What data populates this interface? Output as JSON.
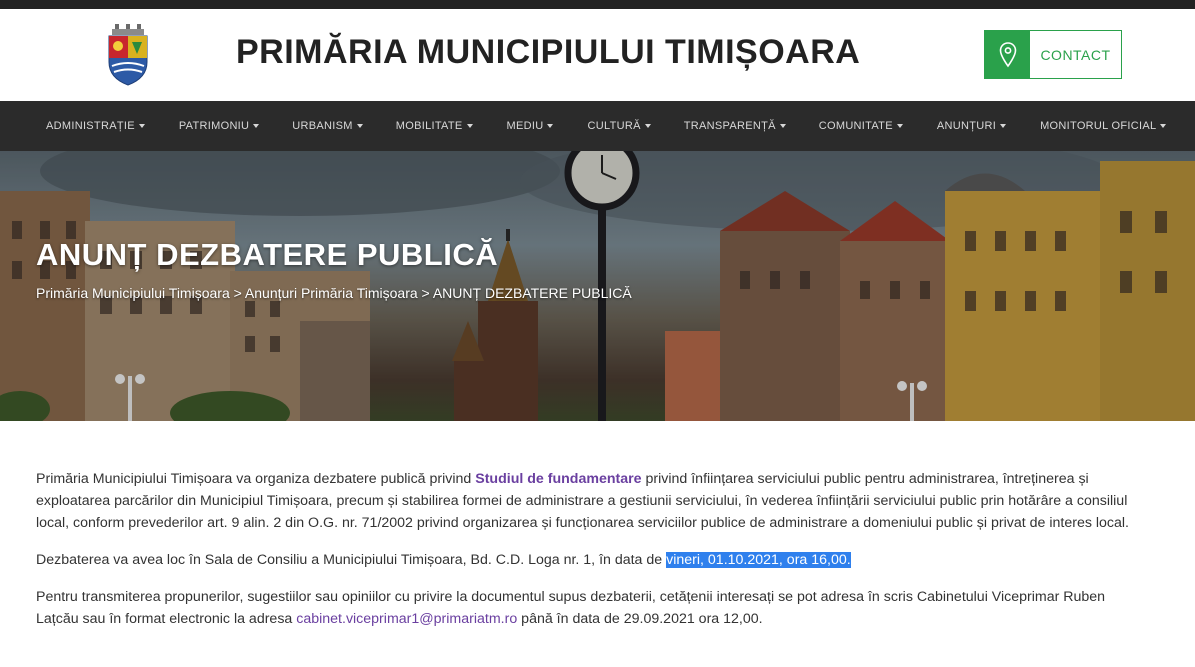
{
  "header": {
    "site_title": "PRIMĂRIA MUNICIPIULUI TIMIȘOARA",
    "contact_label": "CONTACT",
    "accent_color": "#2aa14b"
  },
  "nav": {
    "items": [
      {
        "label": "ADMINISTRAȚIE"
      },
      {
        "label": "PATRIMONIU"
      },
      {
        "label": "URBANISM"
      },
      {
        "label": "MOBILITATE"
      },
      {
        "label": "MEDIU"
      },
      {
        "label": "CULTURĂ"
      },
      {
        "label": "TRANSPARENȚĂ"
      },
      {
        "label": "COMUNITATE"
      },
      {
        "label": "ANUNȚURI"
      },
      {
        "label": "MONITORUL OFICIAL"
      }
    ]
  },
  "hero": {
    "title": "ANUNȚ DEZBATERE PUBLICĂ",
    "breadcrumb": {
      "home": "Primăria Municipiului Timișoara",
      "sep1": " > ",
      "section": "Anunțuri Primăria Timișoara",
      "sep2": " > ",
      "current": "ANUNȚ DEZBATERE PUBLICĂ"
    }
  },
  "content": {
    "p1_before": "Primăria Municipiului Timișoara va organiza dezbatere publică privind ",
    "p1_link": "Studiul de fundamentare",
    "p1_after": " privind înființarea serviciului public pentru administrarea, întreținerea și exploatarea parcărilor din Municipiul Timișoara, precum și stabilirea formei de administrare a gestiunii serviciului, în vederea înființării serviciului public prin hotărâre a consiliul local, conform prevederilor art. 9 alin. 2 din O.G. nr. 71/2002 privind organizarea și funcționarea serviciilor publice  de administrare a domeniului public și privat de interes local.",
    "p2_before": "Dezbaterea va avea loc în Sala de Consiliu a Municipiului Timișoara, Bd. C.D. Loga nr. 1, în data de ",
    "p2_highlight": "vineri, 01.10.2021, ora 16,00.",
    "p3_before": "Pentru transmiterea propunerilor, sugestiilor sau opiniilor cu privire la documentul supus dezbaterii, cetățenii interesați se pot adresa în scris Cabinetului Viceprimar Ruben Lațcău sau în format electronic la adresa ",
    "p3_email": "cabinet.viceprimar1@primariatm.ro",
    "p3_after": " până în data de 29.09.2021 ora 12,00."
  },
  "icons": {
    "crest": "city-crest-icon",
    "contact": "map-pin-icon",
    "nav_caret": "caret-down-icon"
  }
}
